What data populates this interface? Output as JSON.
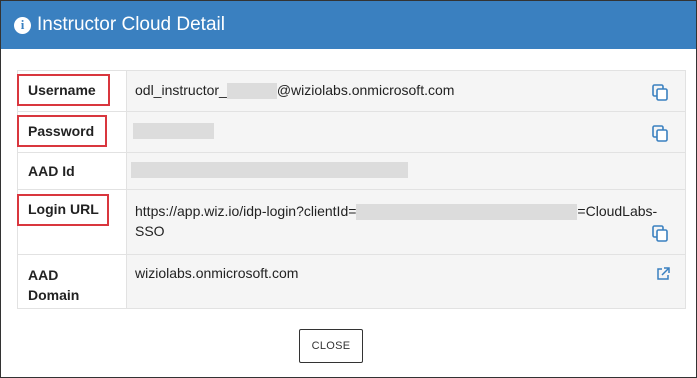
{
  "dialog": {
    "title": "Instructor Cloud Detail",
    "icon": "info-icon"
  },
  "rows": [
    {
      "label": "Username",
      "value_prefix": "odl_instructor_",
      "value_suffix": "@wiziolabs.onmicrosoft.com",
      "action_icon": "copy-icon",
      "highlighted": true
    },
    {
      "label": "Password",
      "value": "",
      "action_icon": "copy-icon",
      "highlighted": true
    },
    {
      "label": "AAD Id",
      "value": "",
      "highlighted": false
    },
    {
      "label": "Login URL",
      "value_prefix": "https://app.wiz.io/idp-login?clientId=",
      "value_suffix": "=CloudLabs-",
      "value_line2": "SSO",
      "action_icon": "copy-icon",
      "highlighted": true
    },
    {
      "label_line1": "AAD",
      "label_line2": "Domain",
      "value": "wiziolabs.onmicrosoft.com",
      "action_icon": "external-link-icon",
      "highlighted": false
    }
  ],
  "footer": {
    "close_label": "CLOSE"
  },
  "colors": {
    "header_bg": "#3a80c0",
    "highlight": "#d9363e",
    "icon_blue": "#3a80c0"
  }
}
